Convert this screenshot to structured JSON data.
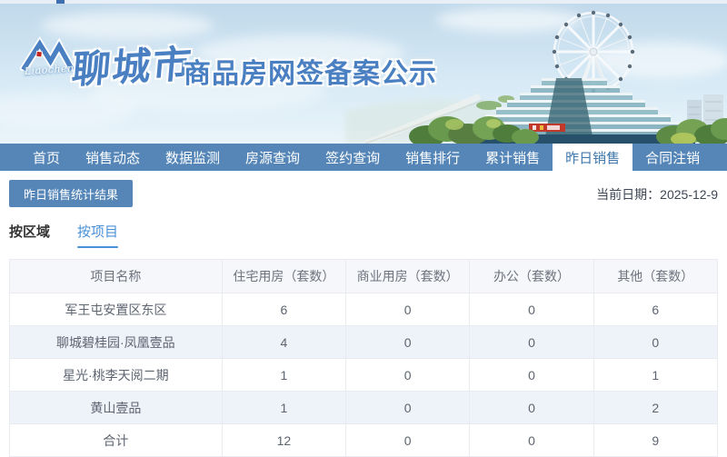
{
  "banner": {
    "logo_subtitle": "Liaocheng",
    "title_script": "聊城市",
    "title_main": "商品房网签备案公示"
  },
  "nav": {
    "items": [
      {
        "label": "首页",
        "active": false
      },
      {
        "label": "销售动态",
        "active": false
      },
      {
        "label": "数据监测",
        "active": false
      },
      {
        "label": "房源查询",
        "active": false
      },
      {
        "label": "签约查询",
        "active": false
      },
      {
        "label": "销售排行",
        "active": false
      },
      {
        "label": "累计销售",
        "active": false
      },
      {
        "label": "昨日销售",
        "active": true
      },
      {
        "label": "合同注销",
        "active": false
      }
    ]
  },
  "toolbar": {
    "stats_button_label": "昨日销售统计结果",
    "date_label": "当前日期：",
    "date_value": "2025-12-9"
  },
  "view_tabs": [
    {
      "label": "按区域",
      "active": false
    },
    {
      "label": "按项目",
      "active": true
    }
  ],
  "table": {
    "headers": [
      "项目名称",
      "住宅用房（套数）",
      "商业用房（套数）",
      "办公（套数）",
      "其他（套数）"
    ],
    "rows": [
      {
        "name": "军王屯安置区东区",
        "values": [
          6,
          0,
          0,
          6
        ]
      },
      {
        "name": "聊城碧桂园·凤凰壹品",
        "values": [
          4,
          0,
          0,
          0
        ]
      },
      {
        "name": "星光·桃李天阅二期",
        "values": [
          1,
          0,
          0,
          1
        ]
      },
      {
        "name": "黄山壹品",
        "values": [
          1,
          0,
          0,
          2
        ]
      },
      {
        "name": "合计",
        "values": [
          12,
          0,
          0,
          9
        ]
      }
    ]
  },
  "colors": {
    "nav_blue": "#5586b7",
    "brand_blue": "#4a80c2",
    "active_nav_text": "#3f78ad",
    "view_tab_accent": "#4a90d9",
    "zebra_row": "#eef3fa",
    "table_border": "#e9ebf1",
    "header_bg": "#f6f7fa"
  }
}
